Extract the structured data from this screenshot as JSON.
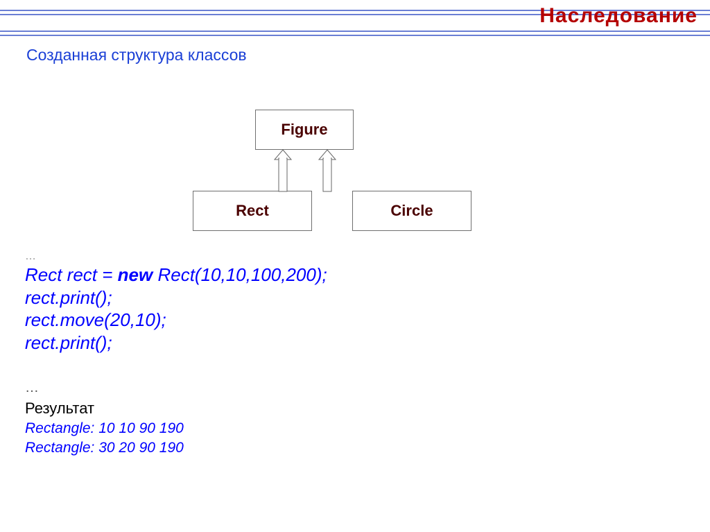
{
  "title": "Наследование",
  "subtitle": "Созданная  структура классов",
  "diagram": {
    "parent": "Figure",
    "childLeft": "Rect",
    "childRight": "Circle"
  },
  "code": {
    "ellipsisTop": "…",
    "line1_pre": "Rect rect = ",
    "line1_kw": "new",
    "line1_post": " Rect(10,10,100,200);",
    "line2": "rect.print();",
    "line3": "rect.move(20,10);",
    "line4": "rect.print();",
    "ellipsisBottom": "…"
  },
  "result": {
    "label": "Результат",
    "line1": "Rectangle: 10  10  90  190",
    "line2": "Rectangle: 30  20  90  190"
  }
}
